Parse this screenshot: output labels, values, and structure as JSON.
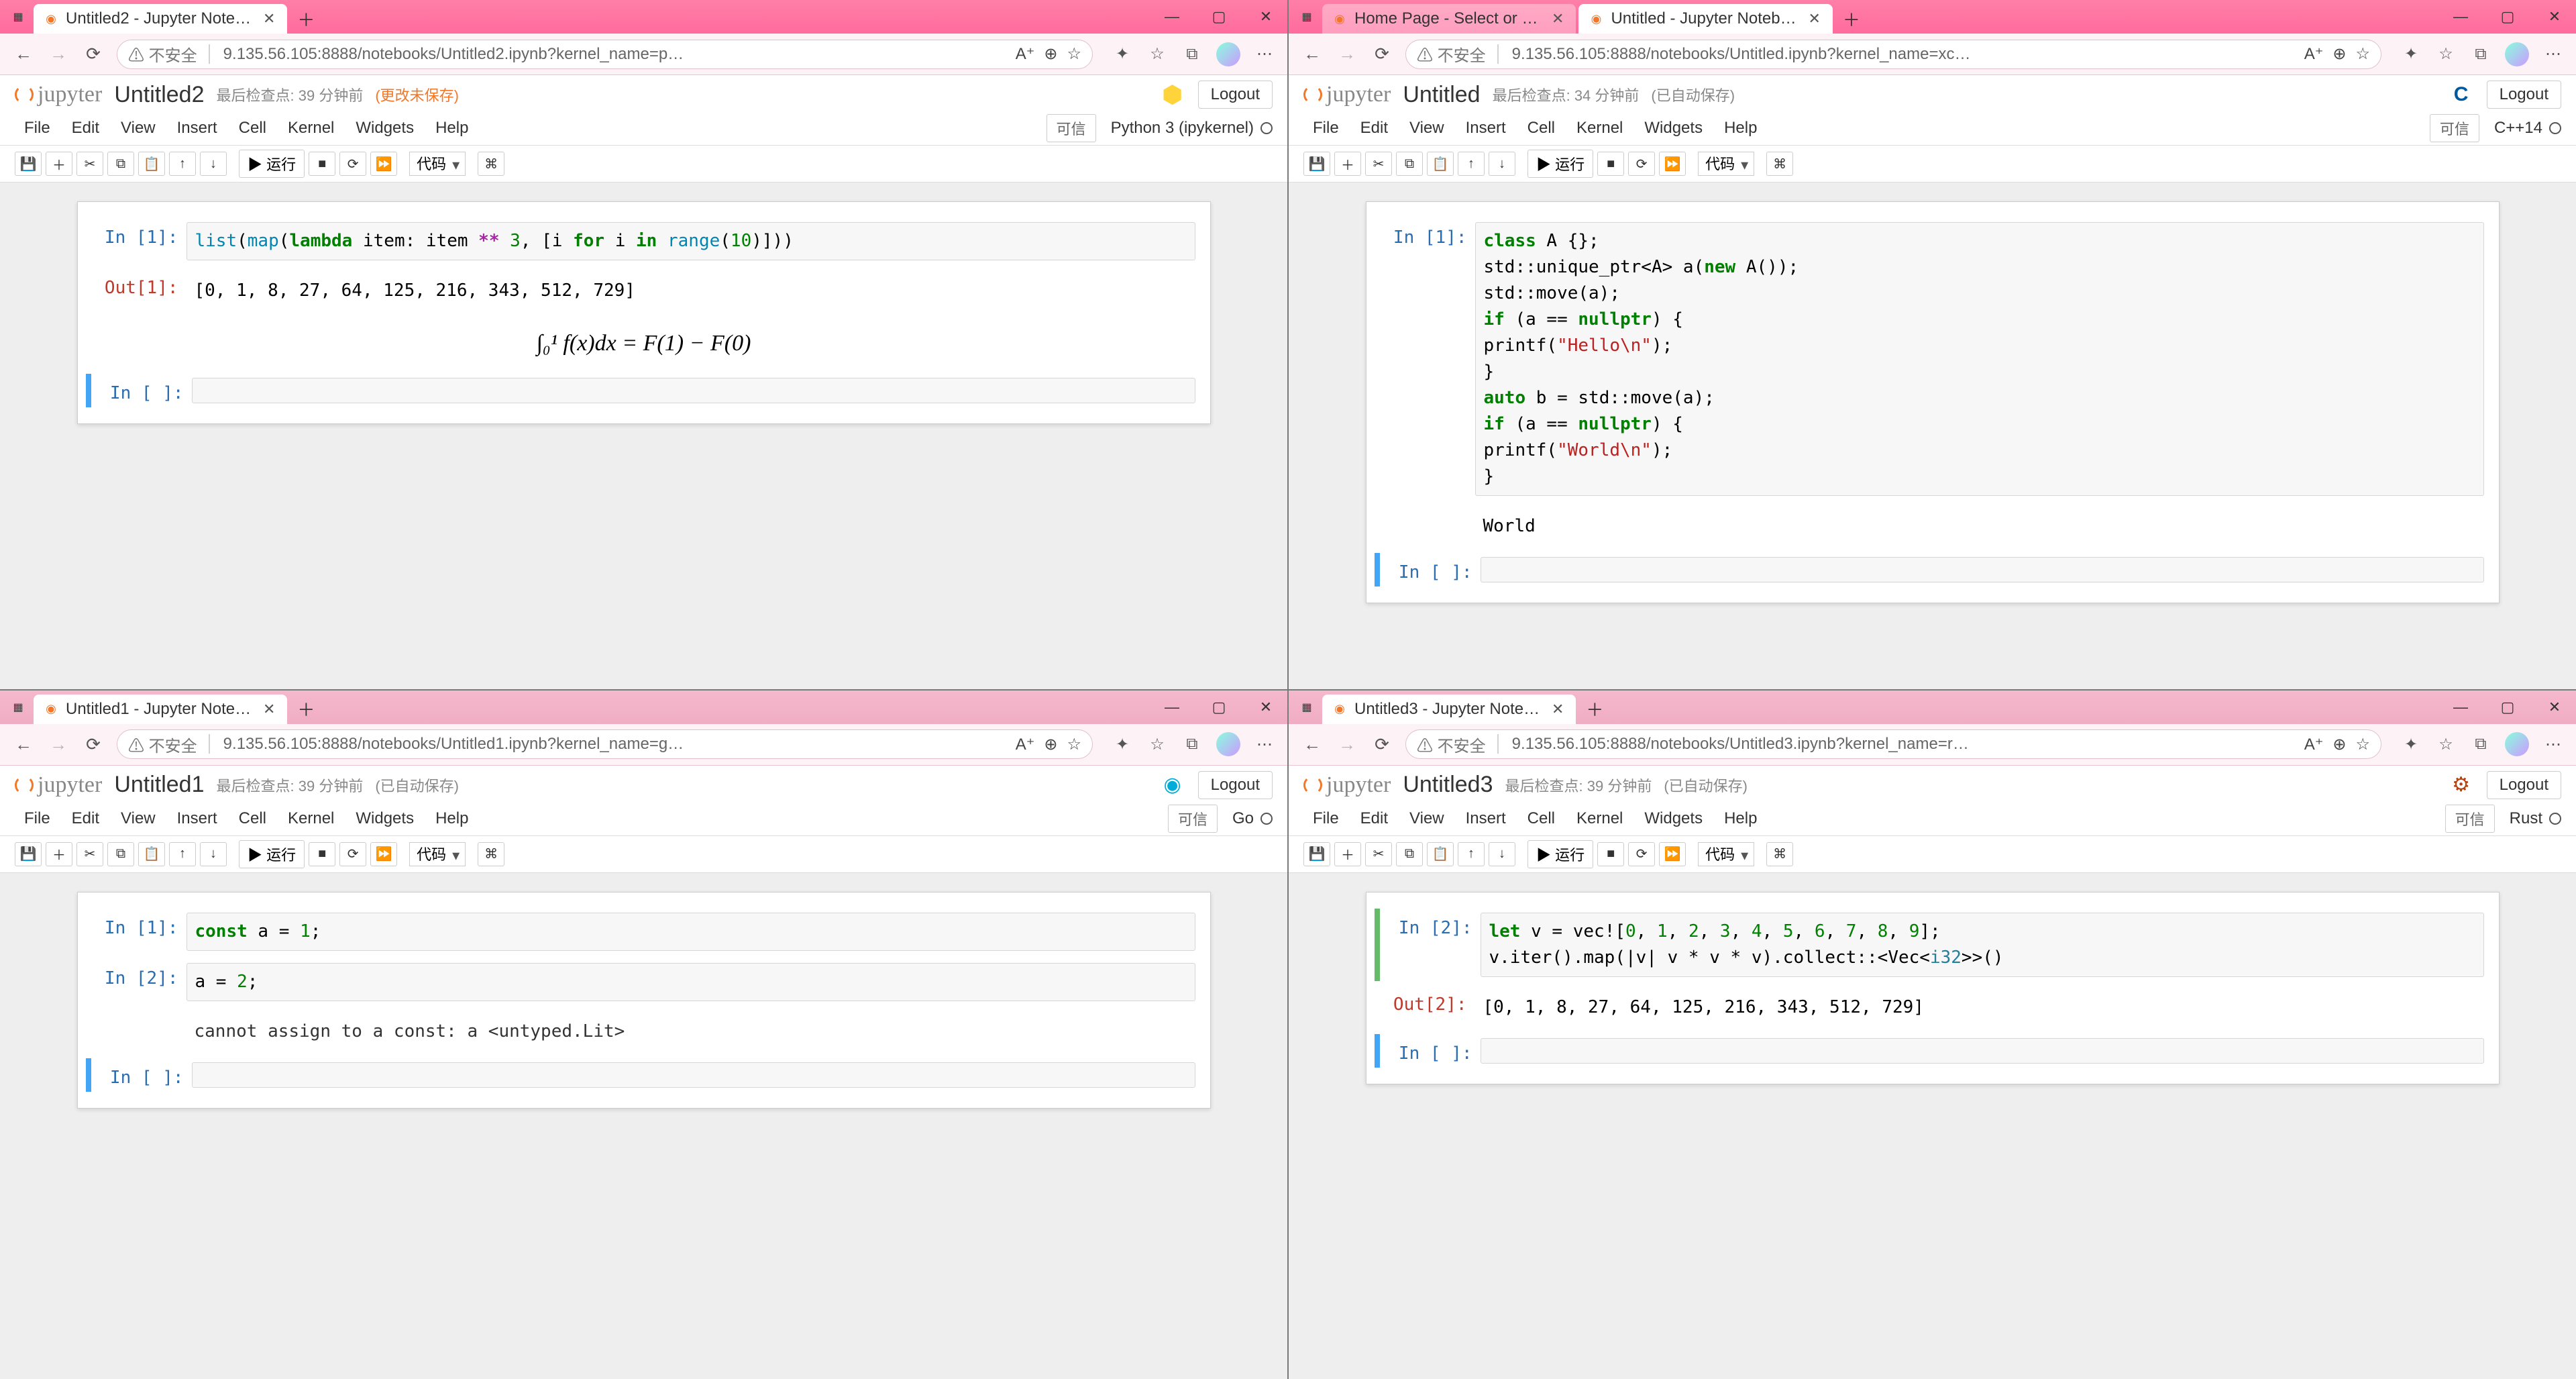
{
  "windows": [
    {
      "id": "tl",
      "active": true,
      "tabs": [
        {
          "title": "Untitled2 - Jupyter Notebook",
          "fav": "jupyter"
        }
      ],
      "url": "9.135.56.105:8888/notebooks/Untitled2.ipynb?kernel_name=p…",
      "insecure": "不安全",
      "notebook_title": "Untitled2",
      "checkpoint": "最后检查点: 39 分钟前",
      "save_status": "(更改未保存)",
      "save_status_color": "orange",
      "kernel_name": "Python 3 (ipykernel)",
      "kernel_logo": "python",
      "cells_kind": "python"
    },
    {
      "id": "tr",
      "active": true,
      "tabs": [
        {
          "title": "Home Page - Select or create a …",
          "bg": true,
          "fav": "jupyter"
        },
        {
          "title": "Untitled - Jupyter Notebook",
          "fav": "jupyter"
        }
      ],
      "url": "9.135.56.105:8888/notebooks/Untitled.ipynb?kernel_name=xc…",
      "insecure": "不安全",
      "notebook_title": "Untitled",
      "checkpoint": "最后检查点: 34 分钟前",
      "save_status": "(已自动保存)",
      "save_status_color": "grey",
      "kernel_name": "C++14",
      "kernel_logo": "cpp",
      "cells_kind": "cpp"
    },
    {
      "id": "bl",
      "active": false,
      "tabs": [
        {
          "title": "Untitled1 - Jupyter Notebook",
          "fav": "jupyter"
        }
      ],
      "url": "9.135.56.105:8888/notebooks/Untitled1.ipynb?kernel_name=g…",
      "insecure": "不安全",
      "notebook_title": "Untitled1",
      "checkpoint": "最后检查点: 39 分钟前",
      "save_status": "(已自动保存)",
      "save_status_color": "grey",
      "kernel_name": "Go",
      "kernel_logo": "go",
      "cells_kind": "go"
    },
    {
      "id": "br",
      "active": false,
      "tabs": [
        {
          "title": "Untitled3 - Jupyter Notebook",
          "fav": "jupyter"
        }
      ],
      "url": "9.135.56.105:8888/notebooks/Untitled3.ipynb?kernel_name=r…",
      "insecure": "不安全",
      "notebook_title": "Untitled3",
      "checkpoint": "最后检查点: 39 分钟前",
      "save_status": "(已自动保存)",
      "save_status_color": "grey",
      "kernel_name": "Rust",
      "kernel_logo": "rust",
      "cells_kind": "rust"
    }
  ],
  "common": {
    "menus": [
      "File",
      "Edit",
      "View",
      "Insert",
      "Cell",
      "Kernel",
      "Widgets",
      "Help"
    ],
    "trusted": "可信",
    "logout": "Logout",
    "run_label": "运行",
    "celltype": "代码",
    "jupyter": "jupyter"
  },
  "cells": {
    "python": {
      "in1_prompt": "In  [1]:",
      "in1_tokens": [
        {
          "t": "list",
          "c": "cm"
        },
        {
          "t": "(",
          "c": ""
        },
        {
          "t": "map",
          "c": "cm"
        },
        {
          "t": "(",
          "c": ""
        },
        {
          "t": "lambda",
          "c": "kw"
        },
        {
          "t": " item: item ",
          "c": ""
        },
        {
          "t": "**",
          "c": "op"
        },
        {
          "t": " ",
          "c": ""
        },
        {
          "t": "3",
          "c": "num"
        },
        {
          "t": ", [i ",
          "c": ""
        },
        {
          "t": "for",
          "c": "kw"
        },
        {
          "t": " i ",
          "c": ""
        },
        {
          "t": "in",
          "c": "kw"
        },
        {
          "t": " ",
          "c": ""
        },
        {
          "t": "range",
          "c": "cm"
        },
        {
          "t": "(",
          "c": ""
        },
        {
          "t": "10",
          "c": "num"
        },
        {
          "t": ")]))",
          "c": ""
        }
      ],
      "out1_prompt": "Out[1]:",
      "out1_text": "[0, 1, 8, 27, 64, 125, 216, 343, 512, 729]",
      "md_latex": "∫₀¹ f(x)dx = F(1) − F(0)",
      "empty_prompt": "In  [ ]:"
    },
    "cpp": {
      "in1_prompt": "In  [1]:",
      "lines": [
        [
          {
            "t": "class",
            "c": "kw"
          },
          {
            "t": " A {};",
            "c": ""
          }
        ],
        [
          {
            "t": "std::unique_ptr<A> a(",
            "c": ""
          },
          {
            "t": "new",
            "c": "kw"
          },
          {
            "t": " A());",
            "c": ""
          }
        ],
        [
          {
            "t": "std::move(a);",
            "c": ""
          }
        ],
        [
          {
            "t": "if",
            "c": "kw"
          },
          {
            "t": " (a == ",
            "c": ""
          },
          {
            "t": "nullptr",
            "c": "kw"
          },
          {
            "t": ") {",
            "c": ""
          }
        ],
        [
          {
            "t": "    printf(",
            "c": ""
          },
          {
            "t": "\"Hello\\n\"",
            "c": "str"
          },
          {
            "t": ");",
            "c": ""
          }
        ],
        [
          {
            "t": "}",
            "c": ""
          }
        ],
        [
          {
            "t": "auto",
            "c": "kw"
          },
          {
            "t": " b = std::move(a);",
            "c": ""
          }
        ],
        [
          {
            "t": "if",
            "c": "kw"
          },
          {
            "t": " (a == ",
            "c": ""
          },
          {
            "t": "nullptr",
            "c": "kw"
          },
          {
            "t": ") {",
            "c": ""
          }
        ],
        [
          {
            "t": "    printf(",
            "c": ""
          },
          {
            "t": "\"World\\n\"",
            "c": "str"
          },
          {
            "t": ");",
            "c": ""
          }
        ],
        [
          {
            "t": "}",
            "c": ""
          }
        ]
      ],
      "stdout": "World",
      "empty_prompt": "In  [ ]:"
    },
    "go": {
      "in1_prompt": "In  [1]:",
      "in1_tokens": [
        {
          "t": "const",
          "c": "kw"
        },
        {
          "t": " a = ",
          "c": ""
        },
        {
          "t": "1",
          "c": "num"
        },
        {
          "t": ";",
          "c": ""
        }
      ],
      "in2_prompt": "In  [2]:",
      "in2_tokens": [
        {
          "t": "a = ",
          "c": ""
        },
        {
          "t": "2",
          "c": "num"
        },
        {
          "t": ";",
          "c": ""
        }
      ],
      "err_text": "cannot assign to a const: a <untyped.Lit>",
      "empty_prompt": "In  [ ]:"
    },
    "rust": {
      "in2_prompt": "In  [2]:",
      "lines": [
        [
          {
            "t": "let",
            "c": "kw"
          },
          {
            "t": " v = vec![",
            "c": ""
          },
          {
            "t": "0",
            "c": "num"
          },
          {
            "t": ", ",
            "c": ""
          },
          {
            "t": "1",
            "c": "num"
          },
          {
            "t": ", ",
            "c": ""
          },
          {
            "t": "2",
            "c": "num"
          },
          {
            "t": ", ",
            "c": ""
          },
          {
            "t": "3",
            "c": "num"
          },
          {
            "t": ", ",
            "c": ""
          },
          {
            "t": "4",
            "c": "num"
          },
          {
            "t": ", ",
            "c": ""
          },
          {
            "t": "5",
            "c": "num"
          },
          {
            "t": ", ",
            "c": ""
          },
          {
            "t": "6",
            "c": "num"
          },
          {
            "t": ", ",
            "c": ""
          },
          {
            "t": "7",
            "c": "num"
          },
          {
            "t": ", ",
            "c": ""
          },
          {
            "t": "8",
            "c": "num"
          },
          {
            "t": ", ",
            "c": ""
          },
          {
            "t": "9",
            "c": "num"
          },
          {
            "t": "];",
            "c": ""
          }
        ],
        [
          {
            "t": "v.iter().map(|v| v * v * v).collect::<Vec<",
            "c": ""
          },
          {
            "t": "i32",
            "c": "ty"
          },
          {
            "t": ">>()",
            "c": ""
          }
        ]
      ],
      "out2_prompt": "Out[2]:",
      "out2_text": "[0, 1, 8, 27, 64, 125, 216, 343, 512, 729]",
      "empty_prompt": "In  [ ]:"
    }
  }
}
